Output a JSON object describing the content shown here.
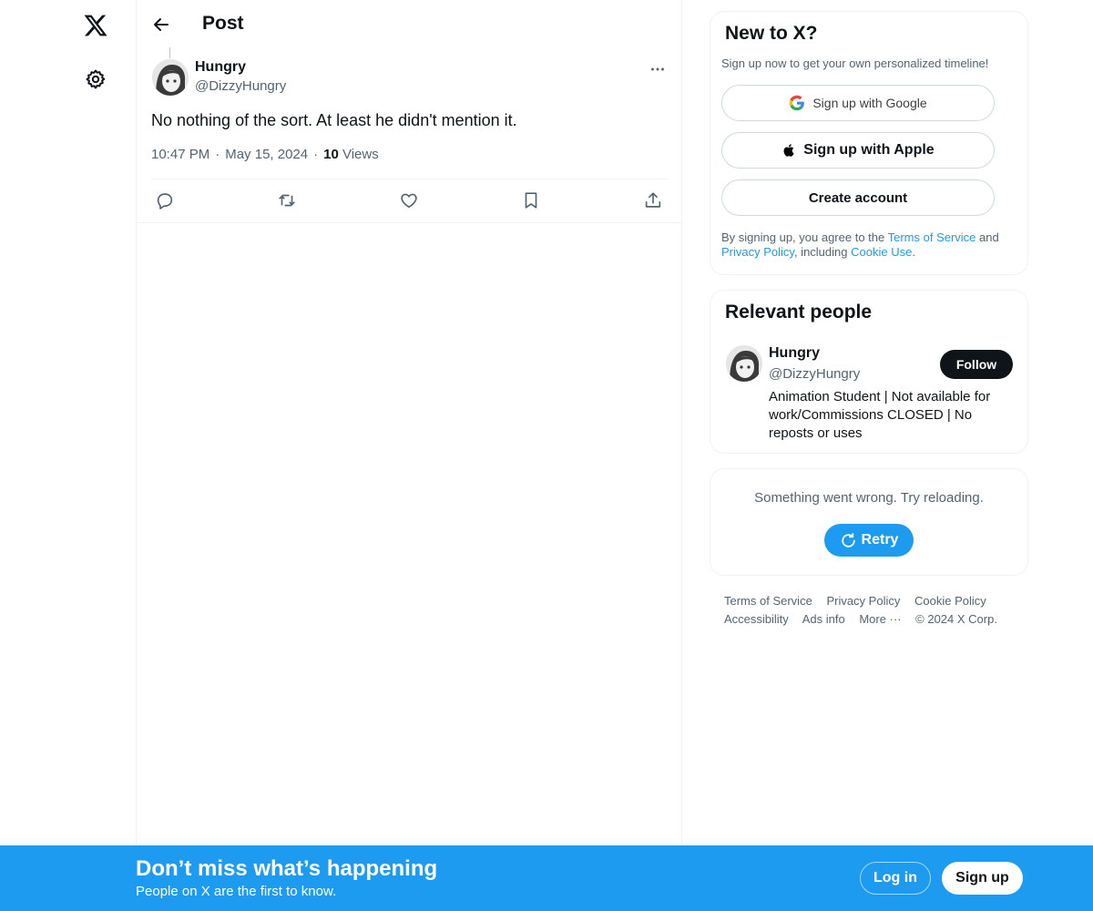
{
  "nav": {
    "logo_icon": "x-logo-icon",
    "settings_icon": "gear-icon"
  },
  "header": {
    "title": "Post",
    "back_icon": "arrow-left-icon"
  },
  "post": {
    "author_name": "Hungry",
    "author_handle": "@DizzyHungry",
    "text": "No nothing of the sort. At least he didn't mention it.",
    "time": "10:47 PM",
    "date": "May 15, 2024",
    "views_count": "10",
    "views_label": "Views",
    "separator": "·",
    "actions": [
      "reply-icon",
      "repost-icon",
      "like-icon",
      "bookmark-icon",
      "share-icon"
    ]
  },
  "signup_card": {
    "title": "New to X?",
    "subtitle": "Sign up now to get your own personalized timeline!",
    "google_label": "Sign up with Google",
    "apple_label": "Sign up with Apple",
    "create_label": "Create account",
    "legal_prefix": "By signing up, you agree to the ",
    "legal_terms": "Terms of Service",
    "legal_and": " and",
    "legal_privacy": "Privacy Policy",
    "legal_including": ", including ",
    "legal_cookie": "Cookie Use",
    "legal_end": "."
  },
  "relevant_people": {
    "title": "Relevant people",
    "name": "Hungry",
    "handle": "@DizzyHungry",
    "follow_label": "Follow",
    "bio": "Animation Student | Not available for work/Commissions CLOSED | No reposts or uses"
  },
  "error_card": {
    "message": "Something went wrong. Try reloading.",
    "retry_label": "Retry"
  },
  "footer": {
    "terms": "Terms of Service",
    "privacy": "Privacy Policy",
    "cookie": "Cookie Policy",
    "accessibility": "Accessibility",
    "ads": "Ads info",
    "more": "More ···",
    "copyright": "© 2024 X Corp."
  },
  "bottom_bar": {
    "title": "Don’t miss what’s happening",
    "subtitle": "People on X are the first to know.",
    "login_label": "Log in",
    "signup_label": "Sign up"
  },
  "colors": {
    "accent": "#1d9bf0",
    "text": "#0f1419",
    "muted": "#536471",
    "border": "#eff3f4"
  }
}
